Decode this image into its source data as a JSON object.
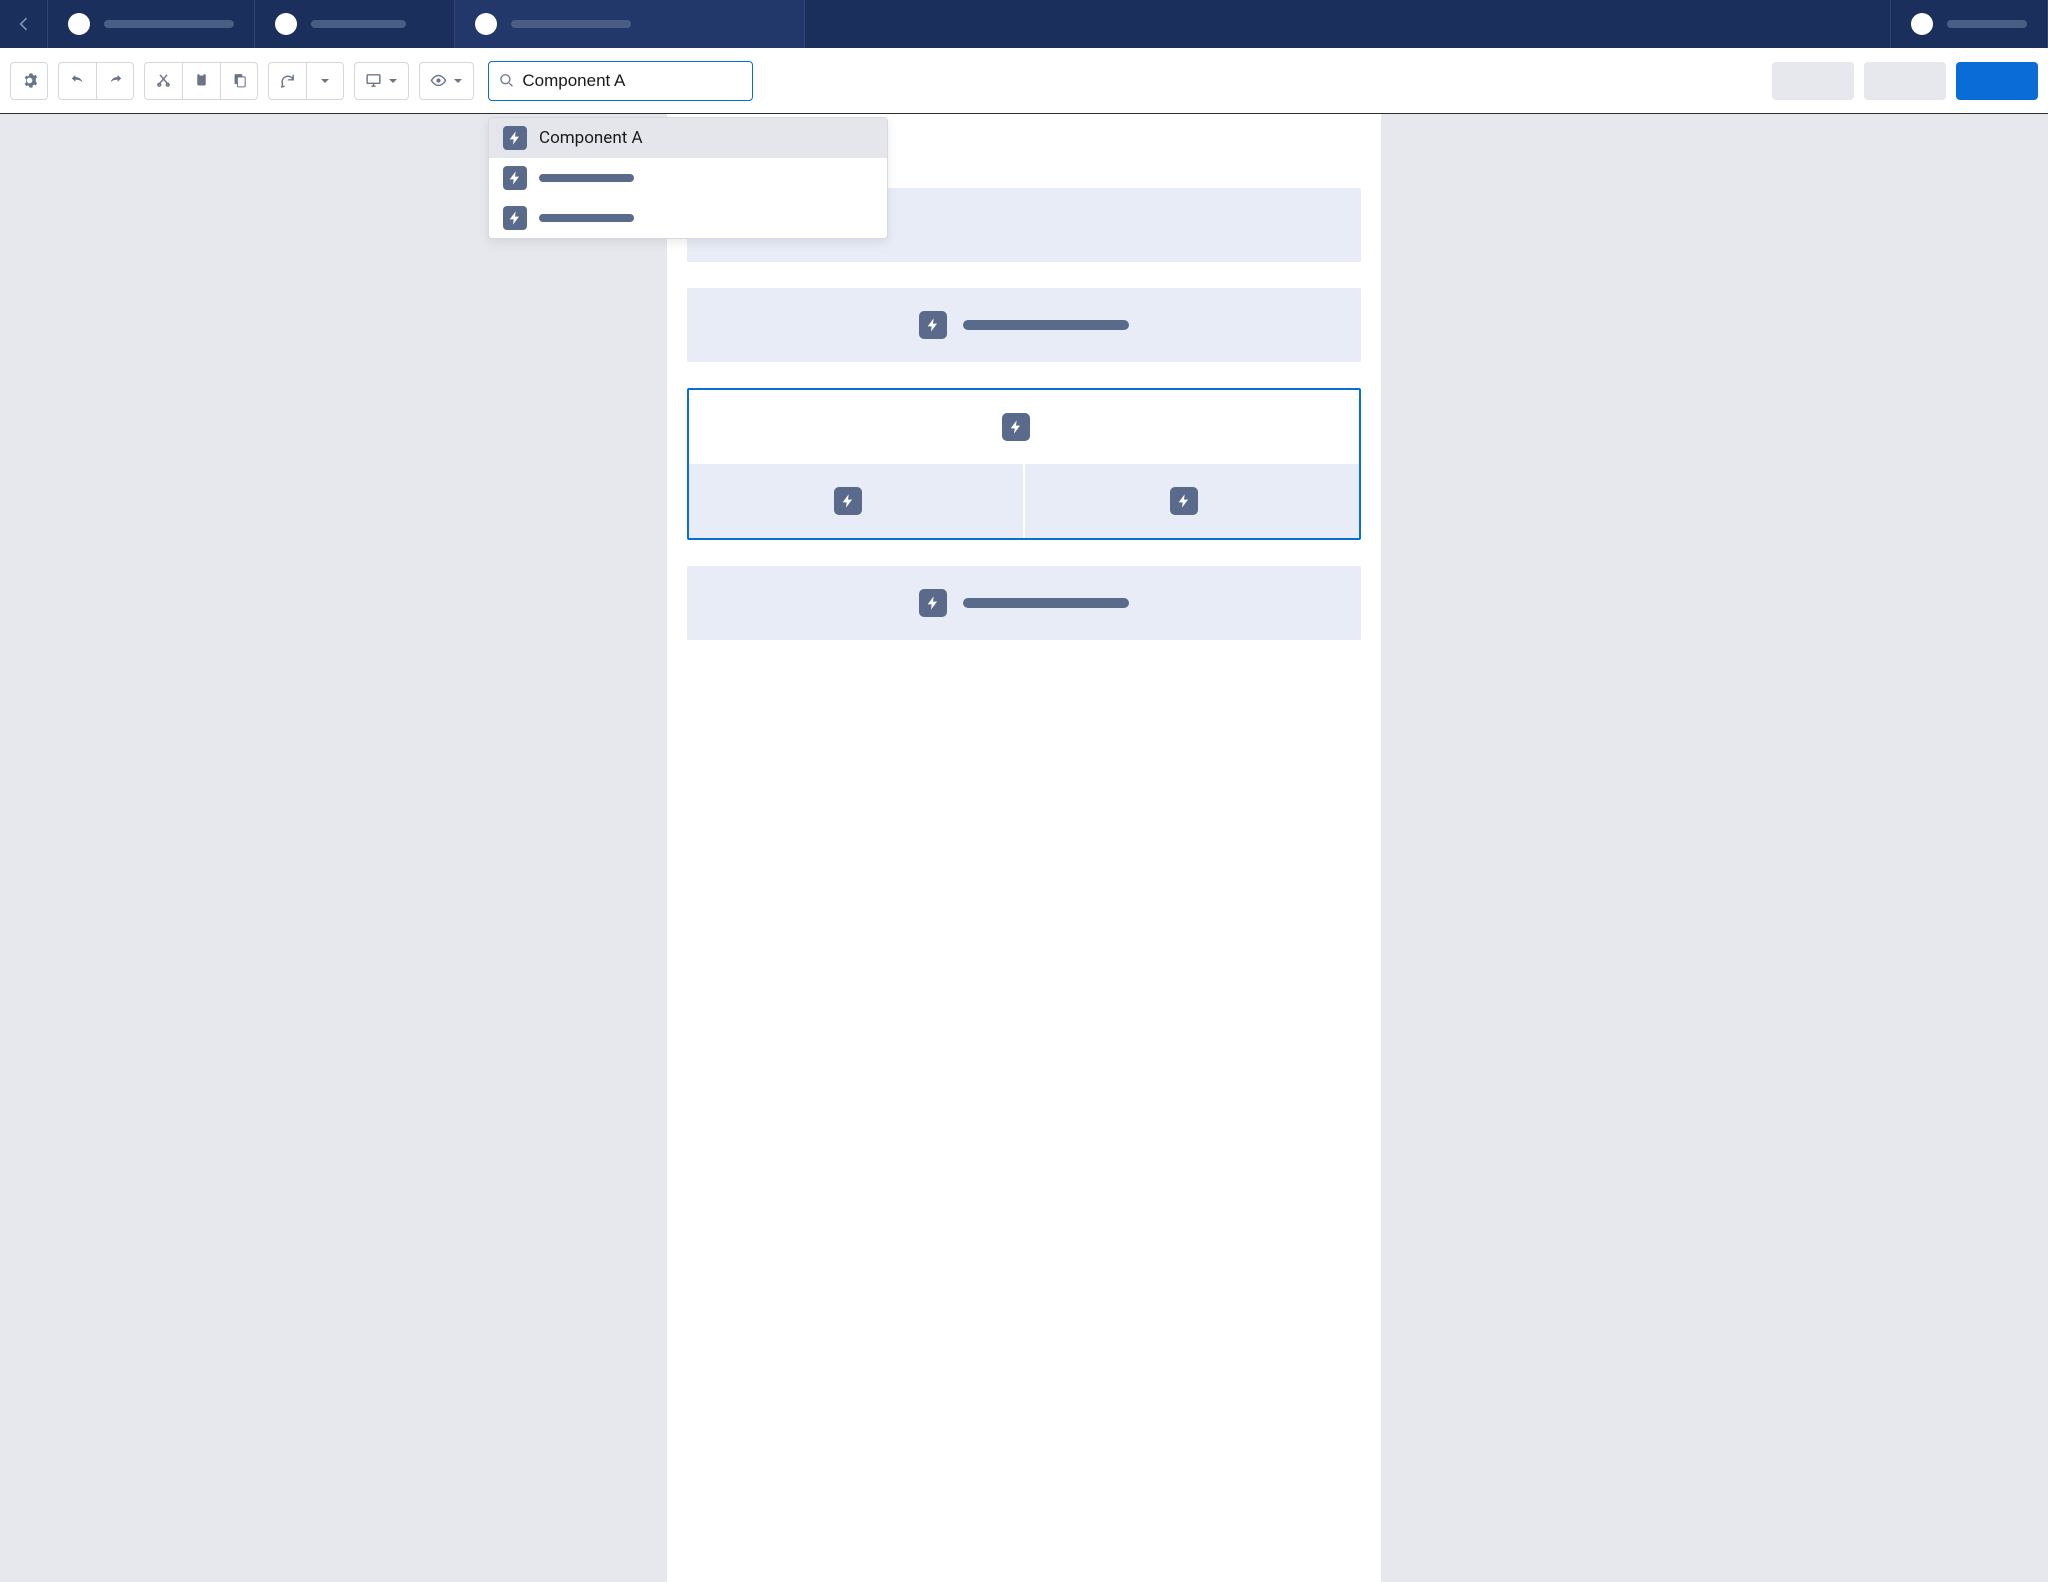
{
  "icons": {
    "back": "back-icon",
    "gear": "gear-icon",
    "undo": "undo-icon",
    "redo": "redo-icon",
    "cut": "cut-icon",
    "copy": "copy-icon",
    "paste": "paste-icon",
    "refresh": "refresh-icon",
    "display": "display-icon",
    "eye": "eye-icon",
    "caret": "caret-down-icon",
    "search": "search-icon",
    "bolt": "bolt-icon"
  },
  "colors": {
    "navbar": "#1b2f5c",
    "accent": "#0a6cd6",
    "canvas_bg": "#e6e8ee",
    "component_bg": "#e8ecf6",
    "placeholder_bar": "#5a6a8a"
  },
  "topnav": {
    "tabs": [
      {
        "label_placeholder": true
      },
      {
        "label_placeholder": true
      },
      {
        "label_placeholder": true,
        "active": true
      }
    ],
    "right_tab": {
      "label_placeholder": true
    }
  },
  "toolbar": {
    "search_value": "Component A",
    "actions": {
      "neutral_1": "",
      "neutral_2": "",
      "primary": ""
    }
  },
  "dropdown": {
    "items": [
      {
        "label": "Component A",
        "highlight": true
      },
      {
        "label_placeholder": true
      },
      {
        "label_placeholder": true
      }
    ]
  },
  "canvas": {
    "blocks": [
      {
        "type": "empty_block"
      },
      {
        "type": "component_block",
        "label_placeholder": true
      },
      {
        "type": "selected_group",
        "header": {
          "label_placeholder": true
        },
        "cells": [
          {
            "label_placeholder": true
          },
          {
            "label_placeholder": true
          }
        ]
      },
      {
        "type": "component_block",
        "label_placeholder": true
      }
    ]
  }
}
